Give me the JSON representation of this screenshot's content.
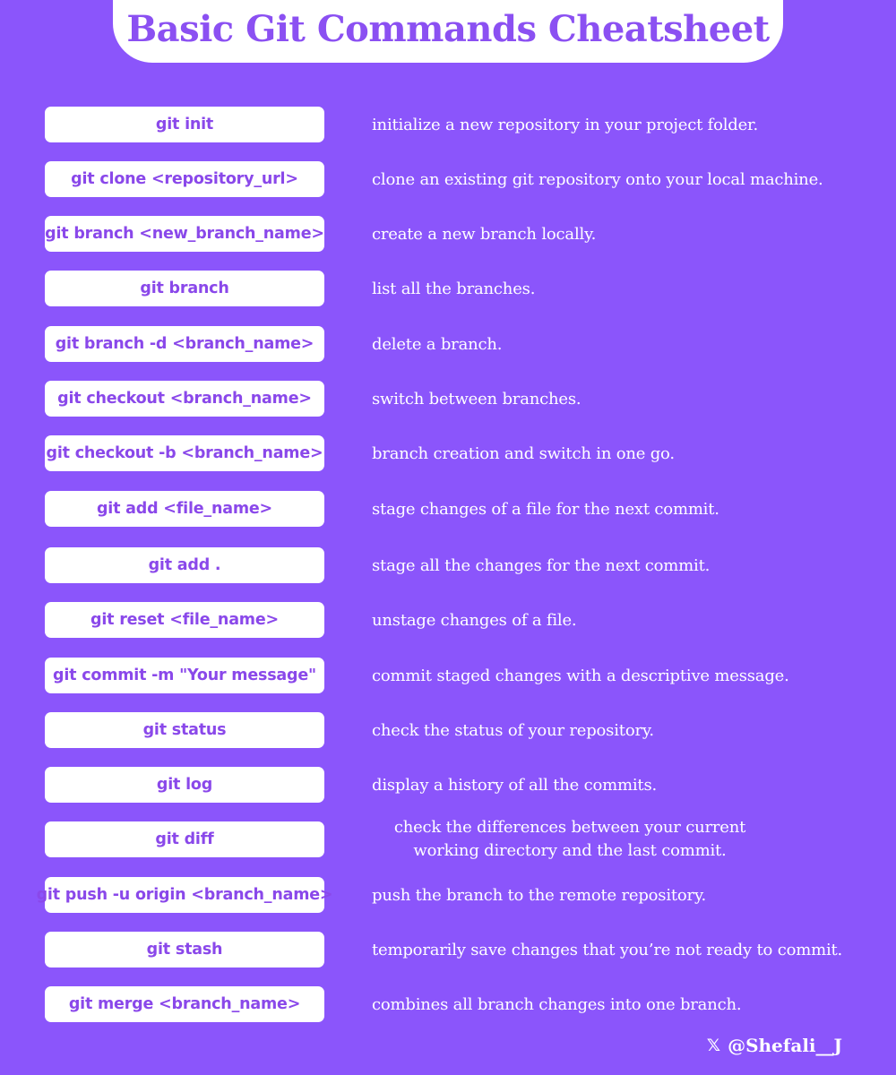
{
  "title": "Basic Git Commands Cheatsheet",
  "commands": [
    {
      "cmd": "git init",
      "desc": "initialize a new repository in your project folder."
    },
    {
      "cmd": "git clone <repository_url>",
      "desc": "clone an existing git repository onto your local machine."
    },
    {
      "cmd": "git branch <new_branch_name>",
      "desc": "create a new branch locally."
    },
    {
      "cmd": "git branch",
      "desc": "list all the branches."
    },
    {
      "cmd": "git branch -d <branch_name>",
      "desc": "delete a branch."
    },
    {
      "cmd": "git checkout <branch_name>",
      "desc": "switch between branches."
    },
    {
      "cmd": "git checkout -b <branch_name>",
      "desc": "branch creation and switch in one go."
    },
    {
      "cmd": "git add <file_name>",
      "desc": "stage changes of a file for the next commit."
    },
    {
      "cmd": "git add .",
      "desc": "stage all the changes for the next commit."
    },
    {
      "cmd": "git reset <file_name>",
      "desc": "unstage changes of a file."
    },
    {
      "cmd": "git commit -m \"Your message\"",
      "desc": "commit staged changes with a descriptive message."
    },
    {
      "cmd": "git status",
      "desc": "check the status of your repository."
    },
    {
      "cmd": "git log",
      "desc": "display a history of all the commits."
    },
    {
      "cmd": "git diff",
      "desc": "check the differences between your current working directory and the last commit."
    },
    {
      "cmd": "git push -u origin <branch_name>",
      "desc": "push the branch to the remote repository."
    },
    {
      "cmd": "git stash",
      "desc": "temporarily save changes that you’re not ready to commit."
    },
    {
      "cmd": "git merge <branch_name>",
      "desc": "combines all branch changes into one branch."
    }
  ],
  "footer": {
    "icon": "x-logo-icon",
    "icon_glyph": "𝕏",
    "handle": "@Shefali__J"
  },
  "colors": {
    "background": "#8b55fb",
    "accent": "#8a48ea",
    "card": "#ffffff"
  }
}
